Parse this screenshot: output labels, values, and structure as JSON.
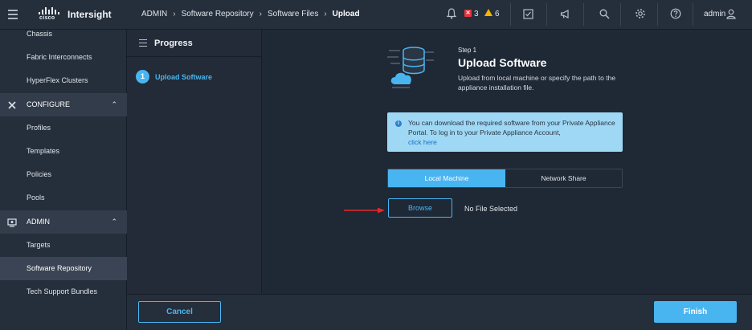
{
  "app": {
    "brand": "Intersight",
    "logo_text": "cisco"
  },
  "breadcrumb": [
    "ADMIN",
    "Software Repository",
    "Software Files",
    "Upload"
  ],
  "topbar": {
    "error_count": "3",
    "warning_count": "6",
    "user": "admin",
    "icons": [
      "bell-icon",
      "error-icon",
      "warning-icon",
      "checklist-icon",
      "megaphone-icon",
      "search-icon",
      "gear-icon",
      "help-icon",
      "user-icon"
    ],
    "colors": {
      "error": "#e8343e",
      "warning": "#f4b400"
    }
  },
  "sidebar": {
    "items": [
      {
        "label": "Chassis",
        "type": "item"
      },
      {
        "label": "Fabric Interconnects",
        "type": "item"
      },
      {
        "label": "HyperFlex Clusters",
        "type": "item"
      },
      {
        "label": "CONFIGURE",
        "type": "section",
        "icon": "wrench-icon"
      },
      {
        "label": "Profiles",
        "type": "item"
      },
      {
        "label": "Templates",
        "type": "item"
      },
      {
        "label": "Policies",
        "type": "item"
      },
      {
        "label": "Pools",
        "type": "item"
      },
      {
        "label": "ADMIN",
        "type": "section",
        "icon": "admin-icon"
      },
      {
        "label": "Targets",
        "type": "item"
      },
      {
        "label": "Software Repository",
        "type": "item",
        "active": true
      },
      {
        "label": "Tech Support Bundles",
        "type": "item"
      }
    ]
  },
  "progress": {
    "title": "Progress",
    "steps": [
      {
        "number": "1",
        "label": "Upload Software"
      }
    ]
  },
  "main": {
    "step_small": "Step 1",
    "step_title": "Upload Software",
    "step_desc": "Upload from local machine or specify the path to the appliance installation file.",
    "info_text": "You can download the required software from your Private Appliance Portal. To log in to your Private Appliance Account,",
    "info_link": "click here",
    "tabs": [
      "Local Machine",
      "Network Share"
    ],
    "browse_label": "Browse",
    "file_status": "No File Selected",
    "accent": "#49b5f0"
  },
  "footer": {
    "cancel_label": "Cancel",
    "finish_label": "Finish"
  }
}
